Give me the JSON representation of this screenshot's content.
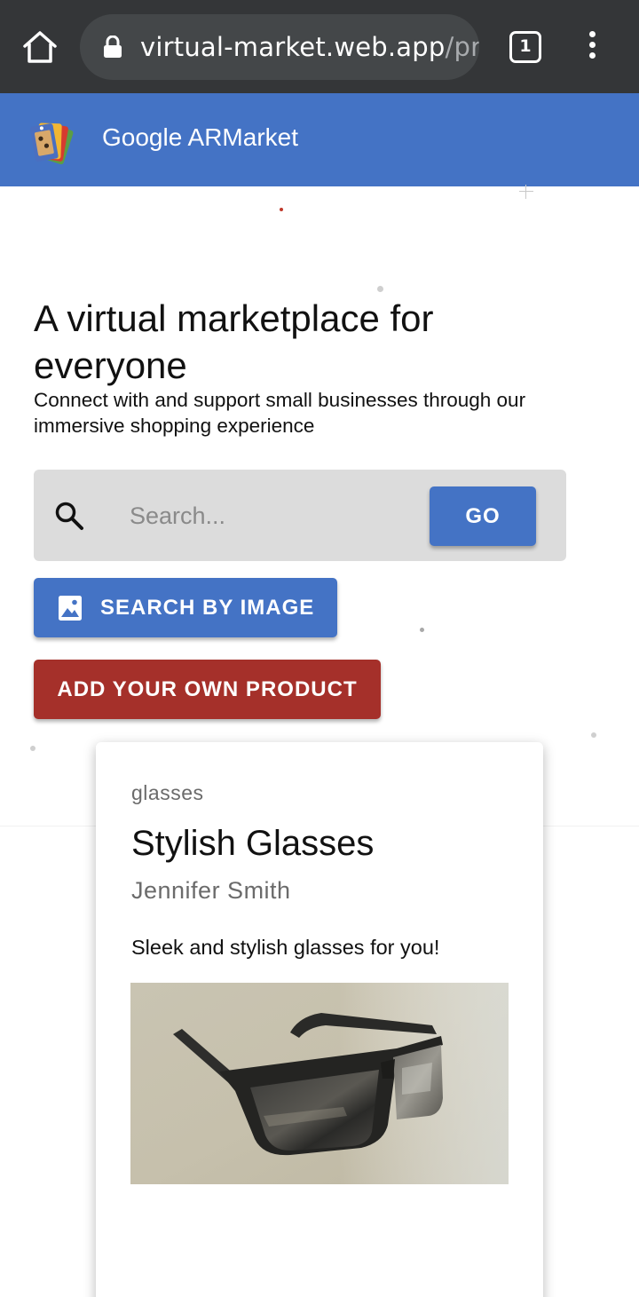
{
  "browser": {
    "url_main": "virtual-market.web.app",
    "url_rest": "/pro",
    "tab_count": "1"
  },
  "appbar": {
    "title": "Google ARMarket"
  },
  "hero": {
    "headline": "A virtual marketplace for everyone",
    "subline": "Connect with and support small businesses through our immersive shopping experience"
  },
  "search": {
    "placeholder": "Search...",
    "go_label": "GO",
    "image_search_label": "SEARCH BY IMAGE"
  },
  "actions": {
    "add_product_label": "ADD YOUR OWN PRODUCT"
  },
  "product": {
    "category": "glasses",
    "title": "Stylish Glasses",
    "seller": "Jennifer Smith",
    "description": "Sleek and stylish glasses for you!",
    "image_alt": "glasses-3d-model"
  },
  "colors": {
    "chrome": "#343638",
    "primary": "#4473c5",
    "accent_red": "#a5302a",
    "search_bg": "#dcdcdc"
  }
}
